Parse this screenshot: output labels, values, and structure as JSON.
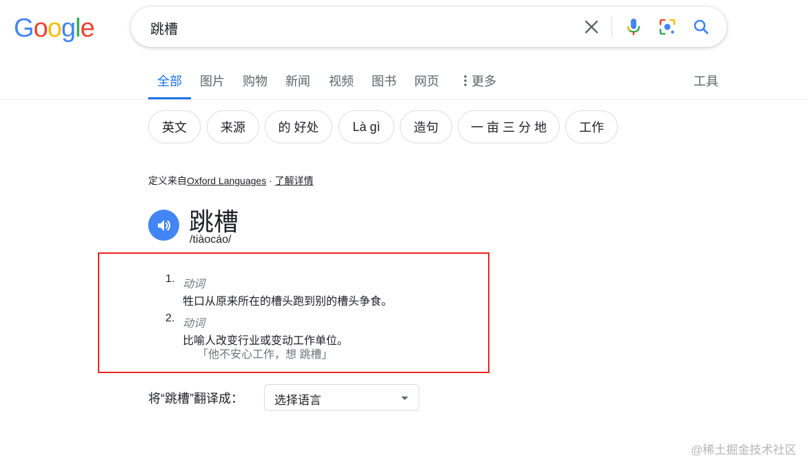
{
  "logo": {
    "letters": [
      "G",
      "o",
      "o",
      "g",
      "l",
      "e"
    ],
    "colors": [
      "#4285f4",
      "#ea4335",
      "#fbbc05",
      "#4285f4",
      "#34a853",
      "#ea4335"
    ]
  },
  "search": {
    "query": "跳槽",
    "icons": [
      "clear-icon",
      "microphone-icon",
      "lens-icon",
      "search-icon"
    ]
  },
  "tabs": [
    {
      "label": "全部",
      "active": true
    },
    {
      "label": "图片",
      "active": false
    },
    {
      "label": "购物",
      "active": false
    },
    {
      "label": "新闻",
      "active": false
    },
    {
      "label": "视频",
      "active": false
    },
    {
      "label": "图书",
      "active": false
    },
    {
      "label": "网页",
      "active": false
    },
    {
      "label": "更多",
      "active": false
    }
  ],
  "tools_label": "工具",
  "chips": [
    "英文",
    "来源",
    "的 好处",
    "Là gì",
    "造句",
    "一 亩 三 分 地",
    "工作"
  ],
  "source": {
    "prefix": "定义来自",
    "provider": "Oxford Languages",
    "separator": "·",
    "learn_more": "了解详情"
  },
  "entry": {
    "headword": "跳槽",
    "phonetic": "/tiàocáo/",
    "definitions": [
      {
        "number": "1.",
        "pos": "动词",
        "text": "牲口从原来所在的槽头跑到别的槽头争食。",
        "example": ""
      },
      {
        "number": "2.",
        "pos": "动词",
        "text": "比喻人改变行业或变动工作单位。",
        "example": "「他不安心工作，想 跳槽」"
      }
    ]
  },
  "translate": {
    "label": "将“跳槽”翻译成：",
    "selected": "选择语言"
  },
  "accent_color": "#1a73e8",
  "highlight_color": "#e8231e",
  "watermark": "@稀土掘金技术社区"
}
